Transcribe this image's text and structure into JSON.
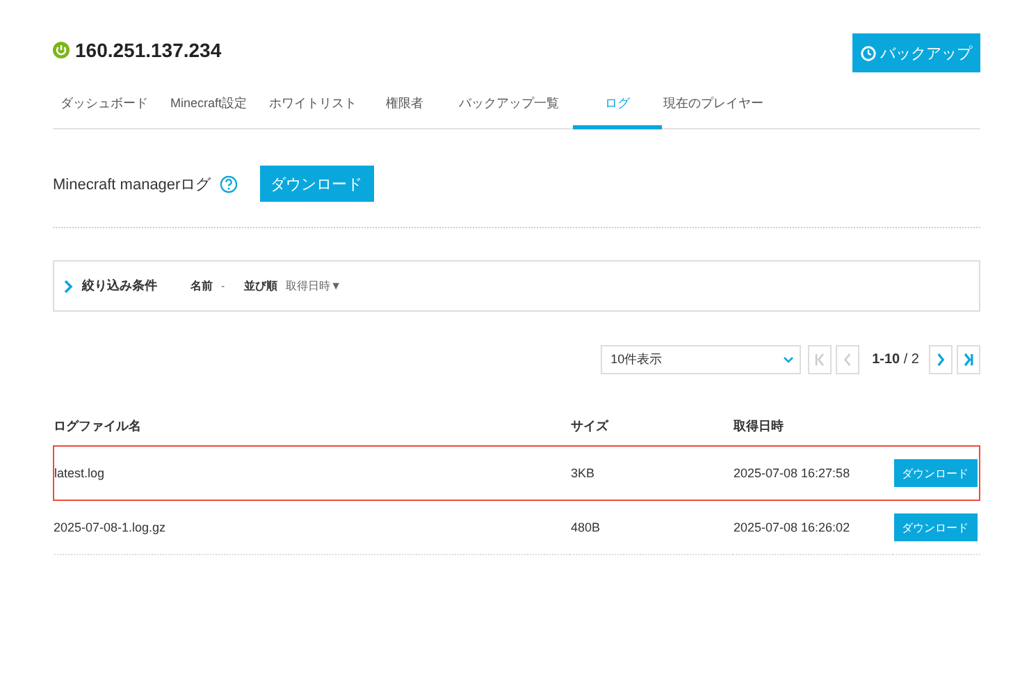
{
  "header": {
    "title": "160.251.137.234",
    "backup_button": "バックアップ"
  },
  "tabs": [
    {
      "label": "ダッシュボード",
      "selected": false
    },
    {
      "label": "Minecraft設定",
      "selected": false
    },
    {
      "label": "ホワイトリスト",
      "selected": false
    },
    {
      "label": "権限者",
      "selected": false
    },
    {
      "label": "バックアップ一覧",
      "selected": false
    },
    {
      "label": "ログ",
      "selected": true
    },
    {
      "label": "現在のプレイヤー",
      "selected": false
    }
  ],
  "section": {
    "title": "Minecraft managerログ",
    "download_button": "ダウンロード"
  },
  "filter": {
    "label": "絞り込み条件",
    "expanded": false,
    "name_label": "名前",
    "name_value": "-",
    "sort_label": "並び順",
    "sort_value": "取得日時▼"
  },
  "pagination": {
    "page_size": "10件表示",
    "range": "1-10",
    "total": "/ 2",
    "buttons": [
      {
        "kind": "first",
        "disabled": true
      },
      {
        "kind": "prev",
        "disabled": true
      },
      {
        "kind": "next",
        "disabled": false
      },
      {
        "kind": "last",
        "disabled": false
      }
    ]
  },
  "table": {
    "columns": [
      "ログファイル名",
      "サイズ",
      "取得日時"
    ],
    "rows": [
      {
        "name": "latest.log",
        "size": "3KB",
        "date": "2025-07-08 16:27:58",
        "button": "ダウンロード",
        "highlighted": true
      },
      {
        "name": "2025-07-08-1.log.gz",
        "size": "480B",
        "date": "2025-07-08 16:26:02",
        "button": "ダウンロード",
        "highlighted": false
      }
    ]
  }
}
